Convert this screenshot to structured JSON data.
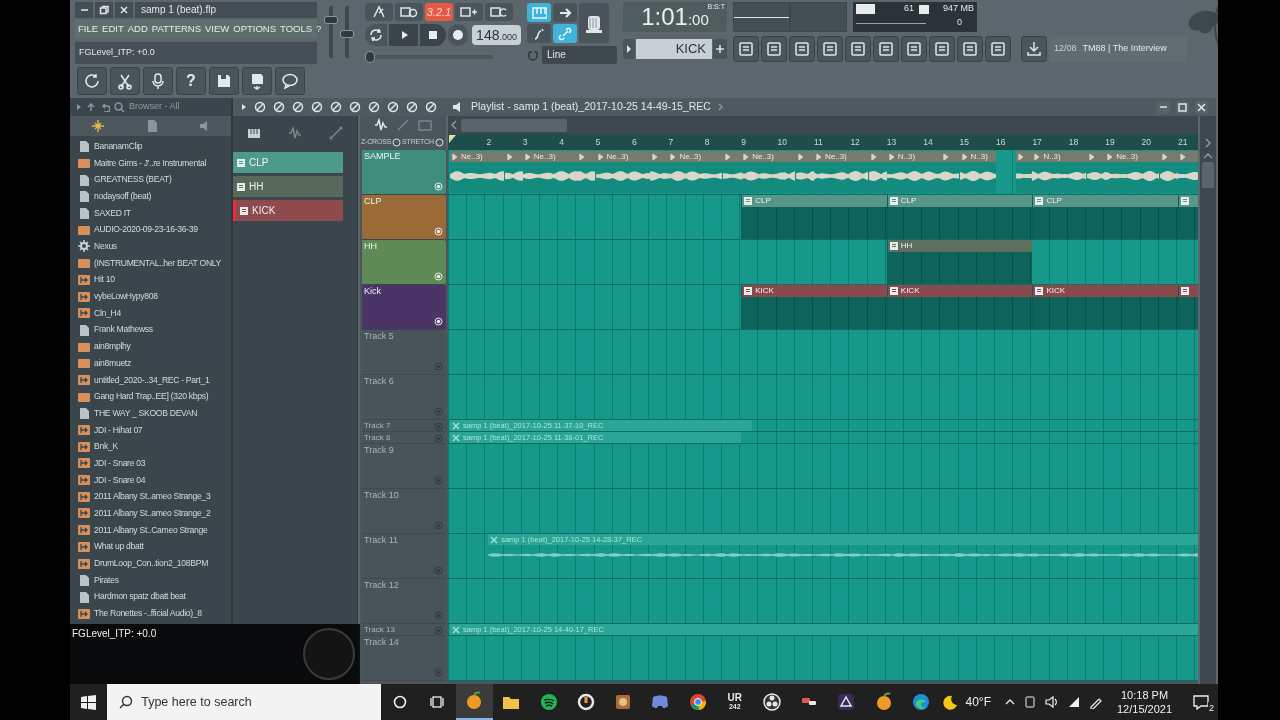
{
  "window": {
    "title": "samp 1 (beat).flp"
  },
  "menu": [
    "FILE",
    "EDIT",
    "ADD",
    "PATTERNS",
    "VIEW",
    "OPTIONS",
    "TOOLS",
    "?"
  ],
  "hint": "FGLevel_ITP: +0.0",
  "master_sliders": [
    {
      "level": 0.78
    },
    {
      "level": 0.45
    }
  ],
  "countdown": {
    "label": "3.2.1",
    "on": true
  },
  "tempo": {
    "main": "148",
    "fraction": ".000"
  },
  "position": {
    "level": 0
  },
  "snap_toggles": [
    {
      "on": true
    },
    {
      "on": false
    },
    {
      "on": false
    },
    {
      "on": true
    }
  ],
  "snap": {
    "value": "Line"
  },
  "time": {
    "main": "1:01",
    "sub": ":00",
    "format": "B:S:T"
  },
  "pattern": {
    "value": "KICK"
  },
  "monitor": {
    "cpu": "61",
    "memory": "947 MB",
    "polyphony": "0",
    "level": 0.5
  },
  "news": {
    "date": "12/08",
    "title": "TM88 | The Interview"
  },
  "help_button": "?",
  "browser": {
    "title": "Browser - All",
    "items": [
      {
        "label": "BananamClip",
        "kind": "file"
      },
      {
        "label": "Maitre Gims - J'..re Instrumental",
        "kind": "mp3"
      },
      {
        "label": "GREATNESS (BEAT)",
        "kind": "file"
      },
      {
        "label": "nodaysoff (beat)",
        "kind": "file"
      },
      {
        "label": "SAXED IT",
        "kind": "file"
      },
      {
        "label": "AUDIO-2020-09-23-16-36-39",
        "kind": "mp3"
      },
      {
        "label": "Nexus",
        "kind": "plugin"
      },
      {
        "label": "(INSTRUMENTAL..her BEAT ONLY",
        "kind": "mp3"
      },
      {
        "label": "Hit 10",
        "kind": "wav"
      },
      {
        "label": "vybeLowHypy808",
        "kind": "wav"
      },
      {
        "label": "Cln_H4",
        "kind": "wav"
      },
      {
        "label": "Frank Mathewss",
        "kind": "file"
      },
      {
        "label": "ain8mplhy",
        "kind": "mp3"
      },
      {
        "label": "ain8muetz",
        "kind": "mp3"
      },
      {
        "label": "untitled_2020-..34_REC - Part_1",
        "kind": "wav"
      },
      {
        "label": "Gang Hard Trap..EE] (320 kbps)",
        "kind": "mp3"
      },
      {
        "label": "THE WAY _ SKOOB DEVAN",
        "kind": "file"
      },
      {
        "label": "JDI - Hihat 07",
        "kind": "wav"
      },
      {
        "label": "Bnk_K",
        "kind": "wav"
      },
      {
        "label": "JDI - Snare 03",
        "kind": "wav"
      },
      {
        "label": "JDI - Snare 04",
        "kind": "wav"
      },
      {
        "label": "2011 Albany St..ameo Strange_3",
        "kind": "wav"
      },
      {
        "label": "2011 Albany St..ameo Strange_2",
        "kind": "wav"
      },
      {
        "label": "2011 Albany St..Cameo Strange",
        "kind": "wav"
      },
      {
        "label": "What up dbatt",
        "kind": "wav"
      },
      {
        "label": "DrumLoop_Con..tion2_108BPM",
        "kind": "wav"
      },
      {
        "label": "Pirates",
        "kind": "file"
      },
      {
        "label": "Hardmon spatz dbatt beat",
        "kind": "file"
      },
      {
        "label": "The Ronettes -..fficial Audio)_8",
        "kind": "wav"
      }
    ]
  },
  "picker": [
    {
      "name": "CLP",
      "color": "#4e9a88",
      "selected": false
    },
    {
      "name": "HH",
      "color": "#56695a",
      "selected": false
    },
    {
      "name": "KICK",
      "color": "#8e4a4c",
      "selected": true
    }
  ],
  "playlist": {
    "title": "Playlist - samp 1 (beat)_2017-10-25 14-49-15_REC",
    "options": [
      "Z-CROSS",
      "STRETCH"
    ],
    "ruler": [
      "2",
      "3",
      "4",
      "5",
      "6",
      "7",
      "8",
      "9",
      "10",
      "11",
      "12",
      "13",
      "14",
      "15",
      "16",
      "17",
      "18",
      "19",
      "20",
      "21"
    ],
    "tracks": [
      {
        "name": "SAMPLE",
        "kind": "normal",
        "color": "#3f8e7c",
        "clips": [
          {
            "kind": "sample",
            "label": "Ne..3)"
          },
          {
            "kind": "sample"
          },
          {
            "kind": "sample",
            "label": "Ne..3)"
          },
          {
            "kind": "sample"
          },
          {
            "kind": "sample",
            "label": "Ne..3)"
          },
          {
            "kind": "sample"
          },
          {
            "kind": "sample",
            "label": "Ne..3)"
          },
          {
            "kind": "sample"
          },
          {
            "kind": "sample",
            "label": "Ne..3)"
          },
          {
            "kind": "sample"
          },
          {
            "kind": "sample",
            "label": "Ne..3)"
          },
          {
            "kind": "sample"
          },
          {
            "kind": "sample",
            "label": "N..3)"
          },
          {
            "kind": "sample"
          },
          {
            "kind": "sample",
            "label": "N..3)"
          },
          {
            "kind": "sample"
          },
          {
            "kind": "sample",
            "label": "N..3)"
          },
          {
            "kind": "sample"
          },
          {
            "kind": "sample",
            "label": "Ne..3)"
          },
          {
            "kind": "sample"
          },
          {
            "kind": "sample"
          }
        ]
      },
      {
        "name": "CLP",
        "kind": "normal",
        "color": "#9a6a37",
        "clips": [
          {
            "kind": "pattern",
            "label": "CLP",
            "color": "#58958b"
          },
          {
            "kind": "pattern",
            "label": "CLP",
            "color": "#58958b"
          },
          {
            "kind": "pattern",
            "label": "CLP",
            "color": "#58958b"
          },
          {
            "kind": "pattern",
            "color": "#58958b"
          }
        ]
      },
      {
        "name": "HH",
        "kind": "normal",
        "color": "#5e8a55",
        "clips": [
          {
            "kind": "pattern",
            "label": "HH",
            "color": "#5f6f5e"
          }
        ]
      },
      {
        "name": "Kick",
        "kind": "normal",
        "color": "#4a3566",
        "clips": [
          {
            "kind": "pattern",
            "label": "KICK",
            "color": "#8a4a4d"
          },
          {
            "kind": "pattern",
            "label": "KICK",
            "color": "#8a4a4d"
          },
          {
            "kind": "pattern",
            "label": "KICK",
            "color": "#8a4a4d"
          },
          {
            "kind": "pattern",
            "color": "#8a4a4d"
          }
        ]
      },
      {
        "name": "Track 5",
        "kind": "normal"
      },
      {
        "name": "Track 6",
        "kind": "normal"
      },
      {
        "name": "Track 7",
        "kind": "compact",
        "clips": [
          {
            "kind": "audio",
            "label": "samp 1 (beat)_2017-10-25 11-37-10_REC"
          }
        ]
      },
      {
        "name": "Track 8",
        "kind": "compact",
        "clips": [
          {
            "kind": "audio",
            "label": "samp 1 (beat)_2017-10-25 11-38-01_REC"
          }
        ]
      },
      {
        "name": "Track 9",
        "kind": "normal"
      },
      {
        "name": "Track 10",
        "kind": "normal"
      },
      {
        "name": "Track 11",
        "kind": "normal",
        "clips": [
          {
            "kind": "audio",
            "label": "samp 1 (beat)_2017-10-25 14-28-37_REC"
          }
        ]
      },
      {
        "name": "Track 12",
        "kind": "normal"
      },
      {
        "name": "Track 13",
        "kind": "compact",
        "clips": [
          {
            "kind": "audio",
            "label": "samp 1 (beat)_2017-10-25 14-40-17_REC"
          }
        ]
      },
      {
        "name": "Track 14",
        "kind": "normal"
      }
    ]
  },
  "overlay": {
    "text": "FGLevel_ITP: +0.0"
  },
  "taskbar": {
    "search_placeholder": "Type here to search",
    "apps": [
      {
        "kind": "fl",
        "selected": true
      },
      {
        "kind": "folder",
        "selected": false
      },
      {
        "kind": "spotify",
        "selected": false
      },
      {
        "kind": "overwatch",
        "selected": false
      },
      {
        "kind": "game",
        "selected": false
      },
      {
        "kind": "discord",
        "selected": false
      },
      {
        "kind": "chrome",
        "selected": false
      },
      {
        "kind": "ur",
        "label": "UR",
        "sub": "242",
        "selected": false
      },
      {
        "kind": "obs",
        "selected": false
      },
      {
        "kind": "app",
        "selected": false
      },
      {
        "kind": "davinci",
        "selected": false
      },
      {
        "kind": "fl",
        "selected": false
      },
      {
        "kind": "edge",
        "selected": false
      }
    ],
    "weather": "40°F",
    "time": "10:18 PM",
    "date": "12/15/2021",
    "notifications": "2"
  }
}
